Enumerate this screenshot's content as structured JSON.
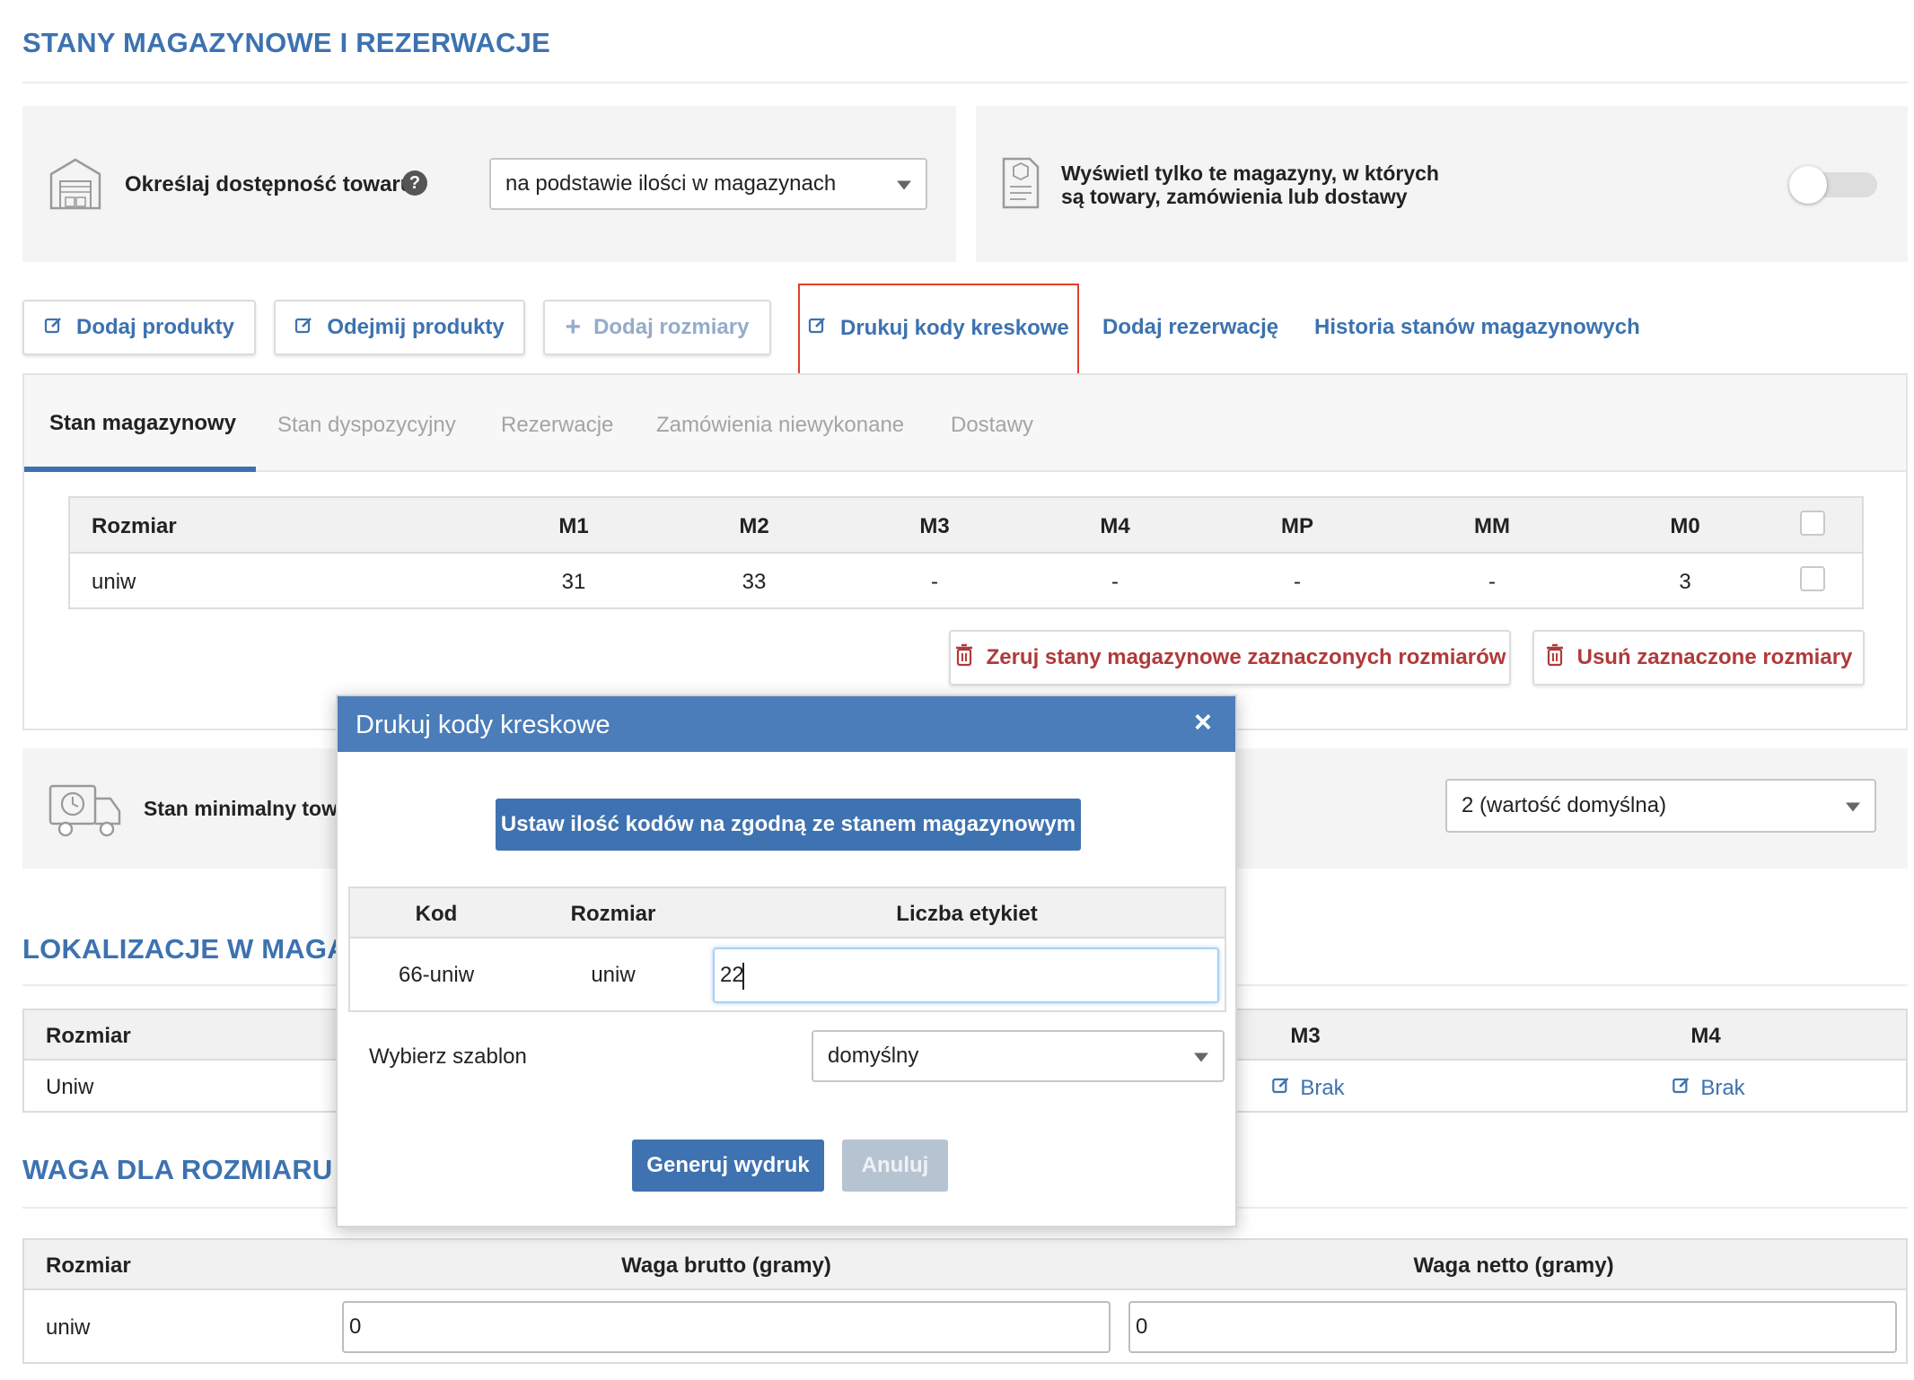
{
  "page": {
    "title": "STANY MAGAZYNOWE I REZERWACJE"
  },
  "availability": {
    "label": "Określaj dostępność towaru",
    "help_icon": "question-circle-icon",
    "select_value": "na podstawie ilości w magazynach",
    "icon": "warehouse-icon"
  },
  "filter": {
    "line1": "Wyświetl tylko te magazyny, w których",
    "line2": "są towary, zamówienia lub dostawy",
    "toggle_on": false,
    "icon": "document-box-icon"
  },
  "actions": {
    "add_products": "Dodaj produkty",
    "subtract_products": "Odejmij produkty",
    "add_sizes": "Dodaj rozmiary",
    "print_barcodes": "Drukuj kody kreskowe",
    "add_reservation": "Dodaj rezerwację",
    "history": "Historia stanów magazynowych",
    "highlight_color": "#e0402c"
  },
  "tabs": [
    {
      "label": "Stan magazynowy",
      "active": true
    },
    {
      "label": "Stan dyspozycyjny",
      "active": false
    },
    {
      "label": "Rezerwacje",
      "active": false
    },
    {
      "label": "Zamówienia niewykonane",
      "active": false
    },
    {
      "label": "Dostawy",
      "active": false
    }
  ],
  "stock_table": {
    "headers": [
      "Rozmiar",
      "M1",
      "M2",
      "M3",
      "M4",
      "MP",
      "MM",
      "M0"
    ],
    "rows": [
      [
        "uniw",
        "31",
        "33",
        "-",
        "-",
        "-",
        "-",
        "3"
      ]
    ]
  },
  "stock_actions": {
    "reset": "Zeruj stany magazynowe zaznaczonych rozmiarów",
    "delete": "Usuń zaznaczone rozmiary"
  },
  "minimum": {
    "label": "Stan minimalny towaru",
    "select_value": "2 (wartość domyślna)",
    "icon": "delivery-truck-clock-icon"
  },
  "locations": {
    "title": "LOKALIZACJE W MAGAZYNACH",
    "headers": [
      "Rozmiar",
      "M3",
      "M4"
    ],
    "rows": [
      {
        "size": "Uniw",
        "m3": "Brak",
        "m4": "Brak"
      }
    ]
  },
  "weight": {
    "title": "WAGA DLA ROZMIARU",
    "headers": [
      "Rozmiar",
      "Waga brutto (gramy)",
      "Waga netto (gramy)"
    ],
    "rows": [
      {
        "size": "uniw",
        "brutto": "0",
        "netto": "0"
      }
    ]
  },
  "modal": {
    "title": "Drukuj kody kreskowe",
    "close": "×",
    "set_qty_button": "Ustaw ilość kodów na zgodną ze stanem magazynowym",
    "table": {
      "headers": [
        "Kod",
        "Rozmiar",
        "Liczba etykiet"
      ],
      "rows": [
        {
          "code": "66-uniw",
          "size": "uniw",
          "labels": "22"
        }
      ]
    },
    "template_label": "Wybierz szablon",
    "template_value": "domyślny",
    "generate": "Generuj wydruk",
    "cancel": "Anuluj",
    "header_color": "#4a7db9"
  }
}
